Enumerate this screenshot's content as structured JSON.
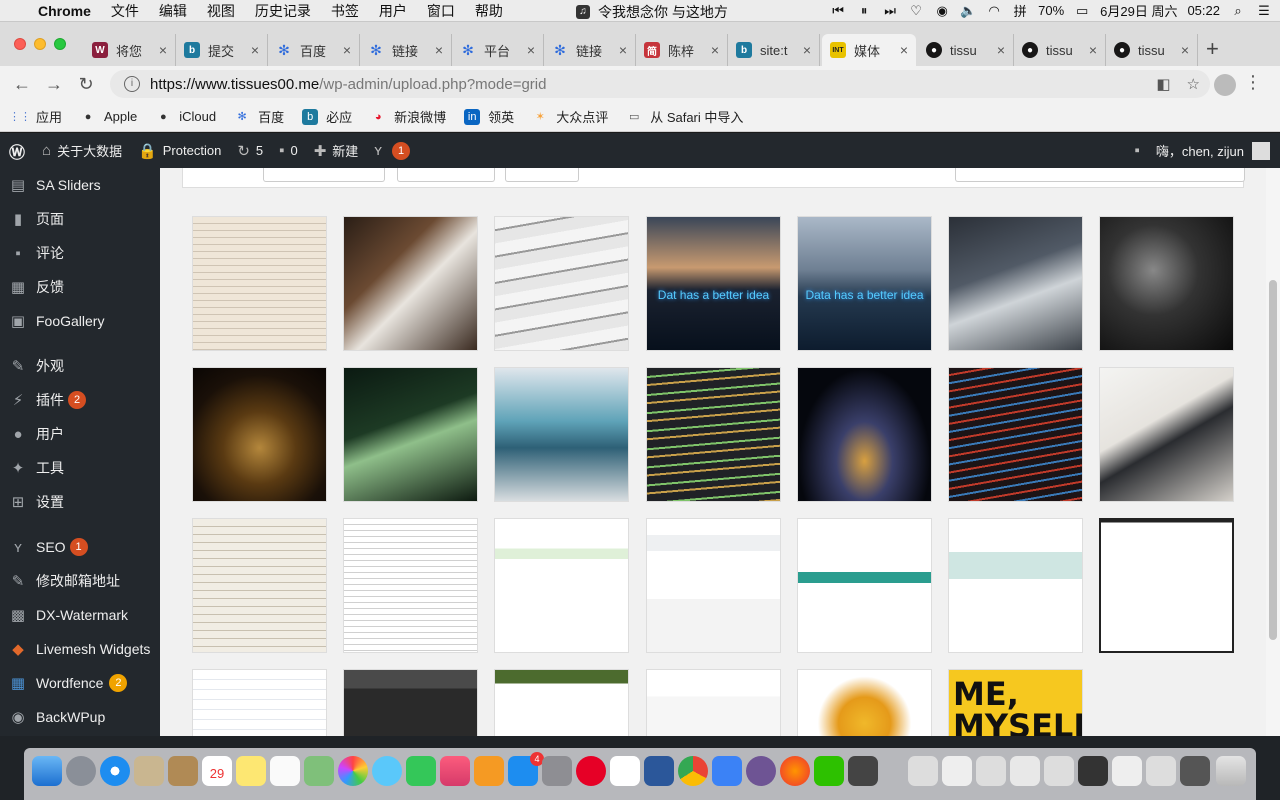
{
  "menubar": {
    "app_name": "Chrome",
    "menus": [
      "文件",
      "编辑",
      "视图",
      "历史记录",
      "书签",
      "用户",
      "窗口",
      "帮助"
    ],
    "now_playing": "令我想念你 与这地方",
    "battery": "70%",
    "date": "6月29日 周六",
    "time": "05:22"
  },
  "tabs": [
    {
      "title": "将您",
      "favicon": "w-icon"
    },
    {
      "title": "提交",
      "favicon": "bing-icon"
    },
    {
      "title": "百度",
      "favicon": "baidu-paw-icon"
    },
    {
      "title": "链接",
      "favicon": "baidu-paw-icon"
    },
    {
      "title": "平台",
      "favicon": "baidu-paw-icon"
    },
    {
      "title": "链接",
      "favicon": "baidu-paw-icon"
    },
    {
      "title": "陈梓",
      "favicon": "jianshu-icon"
    },
    {
      "title": "site:t",
      "favicon": "bing-icon"
    },
    {
      "title": "媒体",
      "favicon": "media-icon",
      "active": true
    },
    {
      "title": "tissu",
      "favicon": "github-icon"
    },
    {
      "title": "tissu",
      "favicon": "github-icon"
    },
    {
      "title": "tissu",
      "favicon": "github-icon"
    }
  ],
  "address_bar": {
    "url_host": "https://www.tissues00.me",
    "url_path": "/wp-admin/upload.php?mode=grid"
  },
  "bookmarks": [
    {
      "label": "应用",
      "icon": "apps-grid-icon"
    },
    {
      "label": "Apple",
      "icon": "apple-icon"
    },
    {
      "label": "iCloud",
      "icon": "apple-icon"
    },
    {
      "label": "百度",
      "icon": "baidu-paw-icon"
    },
    {
      "label": "必应",
      "icon": "bing-icon"
    },
    {
      "label": "新浪微博",
      "icon": "weibo-icon"
    },
    {
      "label": "领英",
      "icon": "linkedin-icon"
    },
    {
      "label": "大众点评",
      "icon": "dianping-icon"
    },
    {
      "label": "从 Safari 中导入",
      "icon": "folder-icon"
    }
  ],
  "admin_bar": {
    "site_name": "关于大数据",
    "protection": "Protection",
    "updates_count": "5",
    "comments_count": "0",
    "new_label": "新建",
    "seo_count": "1",
    "greeting": "嗨，chen, zijun"
  },
  "sidebar": {
    "items": [
      {
        "label": "SA Sliders",
        "icon": "sliders-icon"
      },
      {
        "label": "页面",
        "icon": "page-icon"
      },
      {
        "label": "评论",
        "icon": "comment-icon"
      },
      {
        "label": "反馈",
        "icon": "feedback-icon"
      },
      {
        "label": "FooGallery",
        "icon": "gallery-icon"
      },
      {
        "label": "外观",
        "icon": "brush-icon"
      },
      {
        "label": "插件",
        "icon": "plugin-icon",
        "badge": "2"
      },
      {
        "label": "用户",
        "icon": "user-icon"
      },
      {
        "label": "工具",
        "icon": "wrench-icon"
      },
      {
        "label": "设置",
        "icon": "settings-icon"
      },
      {
        "label": "SEO",
        "icon": "yoast-icon",
        "badge": "1"
      },
      {
        "label": "修改邮箱地址",
        "icon": "edit-icon"
      },
      {
        "label": "DX-Watermark",
        "icon": "watermark-icon"
      },
      {
        "label": "Livemesh Widgets",
        "icon": "livemesh-icon"
      },
      {
        "label": "Wordfence",
        "icon": "wordfence-icon",
        "badge": "2"
      },
      {
        "label": "BackWPup",
        "icon": "backwpup-icon"
      }
    ]
  },
  "media": {
    "captions": {
      "city_dusk": "Dat has a better idea",
      "city_blue": "Data has a better idea",
      "poster_big": "ME, MYSELF"
    }
  },
  "dock": {
    "calendar_day": "29",
    "appstore_badge": "4"
  },
  "colors": {
    "wp_dark": "#23282d",
    "wp_badge": "#d54e21",
    "wordfence_badge": "#f0a300"
  }
}
